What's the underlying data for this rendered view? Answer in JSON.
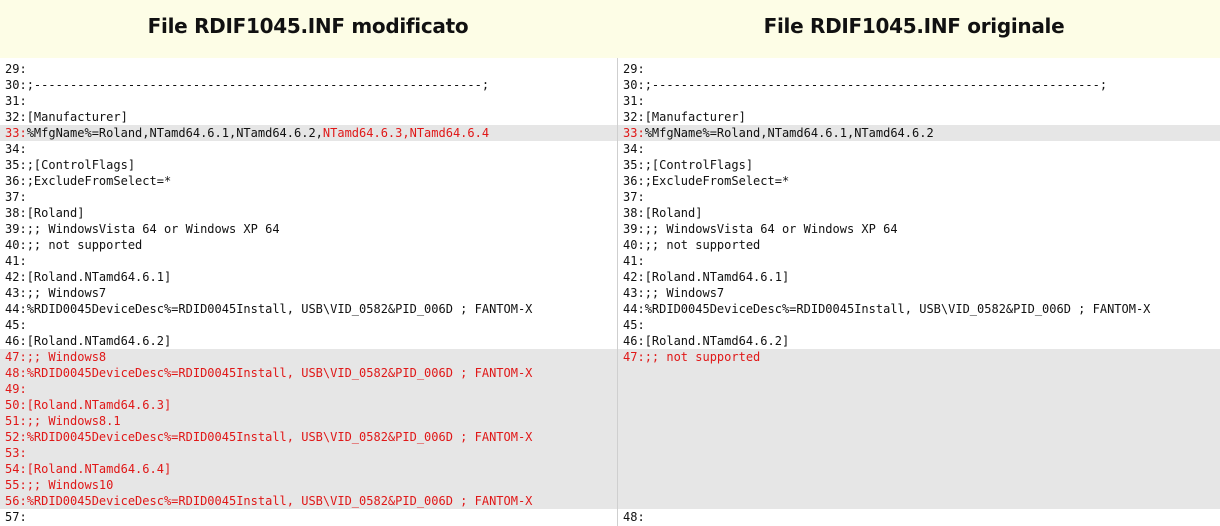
{
  "header": {
    "left_title": "File RDIF1045.INF modificato",
    "right_title": "File RDIF1045.INF originale"
  },
  "colors": {
    "header_bg": "#fdfde6",
    "changed_text": "#e01818",
    "highlight_bg": "#e6e6e6"
  },
  "left_pane": {
    "lines": [
      {
        "num": "29:",
        "text": ""
      },
      {
        "num": "30:",
        "text": ";--------------------------------------------------------------;"
      },
      {
        "num": "31:",
        "text": ""
      },
      {
        "num": "32:",
        "text": "[Manufacturer]"
      },
      {
        "num": "33:",
        "text": "%MfgName%=Roland,NTamd64.6.1,NTamd64.6.2,",
        "text2": "NTamd64.6.3,NTamd64.6.4",
        "state": "highlight"
      },
      {
        "num": "34:",
        "text": ""
      },
      {
        "num": "35:",
        "text": ";[ControlFlags]"
      },
      {
        "num": "36:",
        "text": ";ExcludeFromSelect=*"
      },
      {
        "num": "37:",
        "text": ""
      },
      {
        "num": "38:",
        "text": "[Roland]"
      },
      {
        "num": "39:",
        "text": ";; WindowsVista 64 or Windows XP 64"
      },
      {
        "num": "40:",
        "text": ";; not supported"
      },
      {
        "num": "41:",
        "text": ""
      },
      {
        "num": "42:",
        "text": "[Roland.NTamd64.6.1]"
      },
      {
        "num": "43:",
        "text": ";; Windows7"
      },
      {
        "num": "44:",
        "text": "%RDID0045DeviceDesc%=RDID0045Install, USB\\VID_0582&PID_006D ; FANTOM-X"
      },
      {
        "num": "45:",
        "text": ""
      },
      {
        "num": "46:",
        "text": "[Roland.NTamd64.6.2]"
      },
      {
        "num": "47:",
        "text": ";; Windows8",
        "state": "changed"
      },
      {
        "num": "48:",
        "text": "%RDID0045DeviceDesc%=RDID0045Install, USB\\VID_0582&PID_006D ; FANTOM-X",
        "state": "changed"
      },
      {
        "num": "49:",
        "text": "",
        "state": "changed"
      },
      {
        "num": "50:",
        "text": "[Roland.NTamd64.6.3]",
        "state": "changed"
      },
      {
        "num": "51:",
        "text": ";; Windows8.1",
        "state": "changed"
      },
      {
        "num": "52:",
        "text": "%RDID0045DeviceDesc%=RDID0045Install, USB\\VID_0582&PID_006D ; FANTOM-X",
        "state": "changed"
      },
      {
        "num": "53:",
        "text": "",
        "state": "changed"
      },
      {
        "num": "54:",
        "text": "[Roland.NTamd64.6.4]",
        "state": "changed"
      },
      {
        "num": "55:",
        "text": ";; Windows10",
        "state": "changed"
      },
      {
        "num": "56:",
        "text": "%RDID0045DeviceDesc%=RDID0045Install, USB\\VID_0582&PID_006D ; FANTOM-X",
        "state": "changed"
      },
      {
        "num": "57:",
        "text": ""
      }
    ]
  },
  "right_pane": {
    "lines": [
      {
        "num": "29:",
        "text": ""
      },
      {
        "num": "30:",
        "text": ";--------------------------------------------------------------;"
      },
      {
        "num": "31:",
        "text": ""
      },
      {
        "num": "32:",
        "text": "[Manufacturer]"
      },
      {
        "num": "33:",
        "text": "%MfgName%=Roland,NTamd64.6.1,NTamd64.6.2",
        "state": "highlight"
      },
      {
        "num": "34:",
        "text": ""
      },
      {
        "num": "35:",
        "text": ";[ControlFlags]"
      },
      {
        "num": "36:",
        "text": ";ExcludeFromSelect=*"
      },
      {
        "num": "37:",
        "text": ""
      },
      {
        "num": "38:",
        "text": "[Roland]"
      },
      {
        "num": "39:",
        "text": ";; WindowsVista 64 or Windows XP 64"
      },
      {
        "num": "40:",
        "text": ";; not supported"
      },
      {
        "num": "41:",
        "text": ""
      },
      {
        "num": "42:",
        "text": "[Roland.NTamd64.6.1]"
      },
      {
        "num": "43:",
        "text": ";; Windows7"
      },
      {
        "num": "44:",
        "text": "%RDID0045DeviceDesc%=RDID0045Install, USB\\VID_0582&PID_006D ; FANTOM-X"
      },
      {
        "num": "45:",
        "text": ""
      },
      {
        "num": "46:",
        "text": "[Roland.NTamd64.6.2]"
      },
      {
        "num": "47:",
        "text": ";; not supported",
        "state": "changed"
      },
      {
        "num": "",
        "text": "",
        "state": "pad"
      },
      {
        "num": "",
        "text": "",
        "state": "pad"
      },
      {
        "num": "",
        "text": "",
        "state": "pad"
      },
      {
        "num": "",
        "text": "",
        "state": "pad"
      },
      {
        "num": "",
        "text": "",
        "state": "pad"
      },
      {
        "num": "",
        "text": "",
        "state": "pad"
      },
      {
        "num": "",
        "text": "",
        "state": "pad"
      },
      {
        "num": "",
        "text": "",
        "state": "pad"
      },
      {
        "num": "",
        "text": "",
        "state": "pad"
      },
      {
        "num": "48:",
        "text": ""
      }
    ]
  }
}
